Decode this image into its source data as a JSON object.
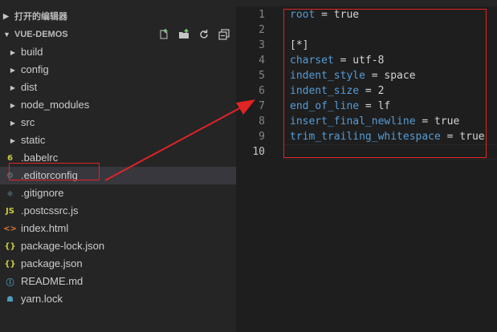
{
  "sidebar": {
    "open_editors": "打开的编辑器",
    "project_name": "VUE-DEMOS",
    "actions": [
      {
        "icon": "new-file-icon"
      },
      {
        "icon": "new-folder-icon"
      },
      {
        "icon": "refresh-icon"
      },
      {
        "icon": "collapse-all-icon"
      }
    ],
    "items": [
      {
        "label": "build",
        "kind": "folder"
      },
      {
        "label": "config",
        "kind": "folder"
      },
      {
        "label": "dist",
        "kind": "folder"
      },
      {
        "label": "node_modules",
        "kind": "folder"
      },
      {
        "label": "src",
        "kind": "folder"
      },
      {
        "label": "static",
        "kind": "folder"
      },
      {
        "label": ".babelrc",
        "kind": "file",
        "icon": "babel-icon",
        "glyph": "6",
        "color": "#cbcb41"
      },
      {
        "label": ".editorconfig",
        "kind": "file",
        "icon": "gear-icon",
        "glyph": "⚙",
        "color": "#6d8086",
        "selected": true
      },
      {
        "label": ".gitignore",
        "kind": "file",
        "icon": "git-icon",
        "glyph": "◆",
        "color": "#41535b"
      },
      {
        "label": ".postcssrc.js",
        "kind": "file",
        "icon": "js-icon",
        "glyph": "JS",
        "color": "#cbcb41"
      },
      {
        "label": "index.html",
        "kind": "file",
        "icon": "html-icon",
        "glyph": "<>",
        "color": "#e37933"
      },
      {
        "label": "package-lock.json",
        "kind": "file",
        "icon": "json-icon",
        "glyph": "{}",
        "color": "#cbcb41"
      },
      {
        "label": "package.json",
        "kind": "file",
        "icon": "json-icon",
        "glyph": "{}",
        "color": "#cbcb41"
      },
      {
        "label": "README.md",
        "kind": "file",
        "icon": "info-icon",
        "glyph": "ⓘ",
        "color": "#519aba"
      },
      {
        "label": "yarn.lock",
        "kind": "file",
        "icon": "yarn-icon",
        "glyph": "☗",
        "color": "#519aba"
      }
    ]
  },
  "editor": {
    "lines": [
      {
        "n": "1",
        "key": "root",
        "op": " = ",
        "val": "true"
      },
      {
        "n": "2"
      },
      {
        "n": "3",
        "section": "[*]"
      },
      {
        "n": "4",
        "key": "charset",
        "op": " = ",
        "val": "utf-8"
      },
      {
        "n": "5",
        "key": "indent_style",
        "op": " = ",
        "val": "space"
      },
      {
        "n": "6",
        "key": "indent_size",
        "op": " = ",
        "val": "2"
      },
      {
        "n": "7",
        "key": "end_of_line",
        "op": " = ",
        "val": "lf"
      },
      {
        "n": "8",
        "key": "insert_final_newline",
        "op": " = ",
        "val": "true"
      },
      {
        "n": "9",
        "key": "trim_trailing_whitespace",
        "op": " = ",
        "val": "true"
      },
      {
        "n": "10",
        "active": true
      }
    ]
  },
  "colors": {
    "annotation_red": "#e02424",
    "key_blue": "#569cd6",
    "sidebar_bg": "#252526",
    "editor_bg": "#1e1e1e",
    "selected_row": "#37373d"
  }
}
